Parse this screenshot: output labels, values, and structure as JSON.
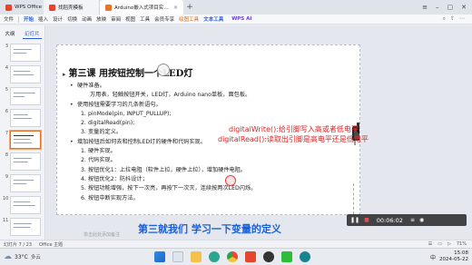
{
  "titlebar": {
    "home_tab": "WPS Office",
    "tabs": [
      {
        "label": "找稻壳模板",
        "icon": "daoke-icon",
        "color": "#e5452e"
      },
      {
        "label": "Arduino嵌入式项目实战教学v0.2",
        "icon": "ppt-file-icon",
        "color": "#e8742a"
      }
    ],
    "new_tab": "+"
  },
  "menubar": {
    "items": [
      "文件",
      "开始",
      "插入",
      "设计",
      "切换",
      "动画",
      "放映",
      "审阅",
      "视图",
      "工具",
      "会员专享"
    ],
    "highlight_items": [
      "绘图工具",
      "文本工具"
    ],
    "ai_label": "WPS AI"
  },
  "leftpane": {
    "tabs": [
      "大纲",
      "幻灯片"
    ],
    "active_tab": "幻灯片",
    "thumbnails": [
      {
        "num": "3",
        "selected": false
      },
      {
        "num": "4",
        "selected": false
      },
      {
        "num": "5",
        "selected": false
      },
      {
        "num": "6",
        "selected": false
      },
      {
        "num": "7",
        "selected": true
      },
      {
        "num": "8",
        "selected": false
      },
      {
        "num": "9",
        "selected": false
      },
      {
        "num": "10",
        "selected": false
      },
      {
        "num": "11",
        "selected": false
      }
    ]
  },
  "slide": {
    "title_arrow": "▸",
    "title": "第三课 用按钮控制一个LED灯",
    "lines": [
      {
        "bullet": "•",
        "text": "硬件准备。",
        "level": 1
      },
      {
        "bullet": "",
        "text": "万用表，轻触按钮开关，LED灯，Arduino nano单板，面包板。",
        "level": 2
      },
      {
        "bullet": "•",
        "text": "使用按钮需要学习的几条新语句。",
        "level": 1
      },
      {
        "bullet": "1.",
        "text": "pinMode(pin, INPUT_PULLUP);",
        "level": 3
      },
      {
        "bullet": "2.",
        "text": "digitalRead(pin);",
        "level": 3
      },
      {
        "bullet": "3.",
        "text": "变量的定义。",
        "level": 3
      },
      {
        "bullet": "•",
        "text": "增加按钮后如何去和控制LED灯的硬件和代码实现。",
        "level": 1
      },
      {
        "bullet": "1.",
        "text": "硬件实现。",
        "level": 3
      },
      {
        "bullet": "2.",
        "text": "代码实现。",
        "level": 3
      },
      {
        "bullet": "3.",
        "text": "按钮优化1：上拉电阻（软件上拉，硬件上拉），增加硬件电阻。",
        "level": 3
      },
      {
        "bullet": "4.",
        "text": "按钮优化2：防抖设计；",
        "level": 3
      },
      {
        "bullet": "5.",
        "text": "按钮功能增强，按下一次亮，再按下一次灭，连续按两次LED闪烁。",
        "level": 3
      },
      {
        "bullet": "6.",
        "text": "按钮中断实现方法。",
        "level": 3
      }
    ],
    "annotation_1": "digitalWrite():给引脚写入高或者低电平",
    "annotation_2": "digitalRead():读取出引脚是高电平还是低电平"
  },
  "player": {
    "time": "00:06:02",
    "controls": [
      "pause-icon",
      "stop-icon",
      "time-display",
      "menu-icon",
      "camera-icon"
    ]
  },
  "subtitle": "第三就我们 学习一下变量的定义",
  "notes_hint": "单击此处添加备注",
  "statusbar": {
    "slide_counter": "幻灯片 7 / 23",
    "theme": "Office 主题",
    "zoom": "71%"
  },
  "taskbar": {
    "weather_temp": "33°C",
    "weather_cond": "多云",
    "time": "15:08",
    "date": "2024-05-22",
    "ime_label": "中"
  },
  "colors": {
    "accent": "#2a5bd7",
    "annotation": "#e02222",
    "subtitle": "#1b5fd6",
    "wps_ai": "#6a3fd6"
  }
}
